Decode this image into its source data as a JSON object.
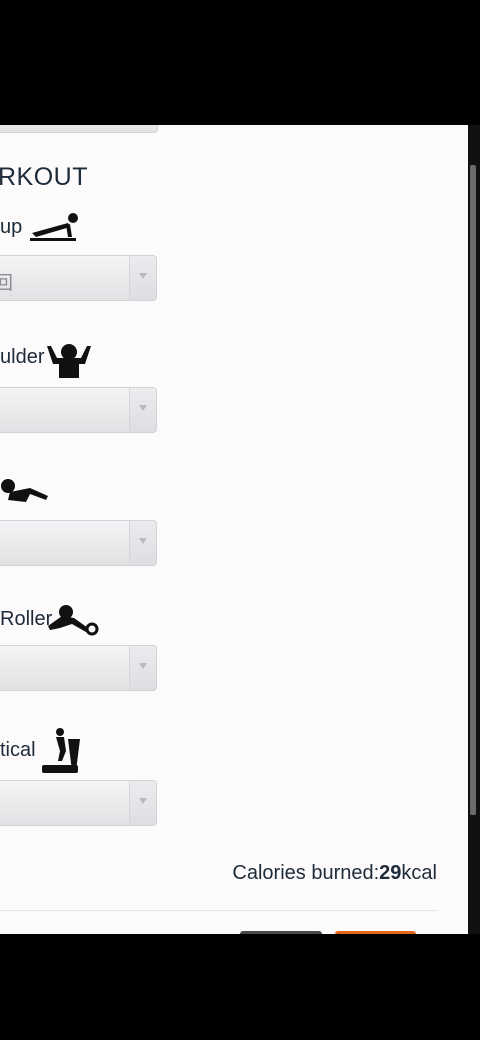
{
  "section": {
    "title": "RKOUT"
  },
  "exercises": [
    {
      "label": "up",
      "value": "回",
      "icon": "pushup-icon"
    },
    {
      "label": "ulder",
      "value": "",
      "icon": "shoulder-icon"
    },
    {
      "label": "",
      "value": "",
      "icon": "situp-icon"
    },
    {
      "label": "Roller",
      "value": "",
      "icon": "ab-roller-icon"
    },
    {
      "label": "tical",
      "value": "",
      "icon": "elliptical-icon"
    }
  ],
  "summary": {
    "calories_label": "Calories burned:",
    "calories_value": "29",
    "calories_unit": "kcal"
  },
  "colors": {
    "text": "#1d2b3a",
    "accent": "#e3661d",
    "secondary_button": "#4a4a4a"
  }
}
